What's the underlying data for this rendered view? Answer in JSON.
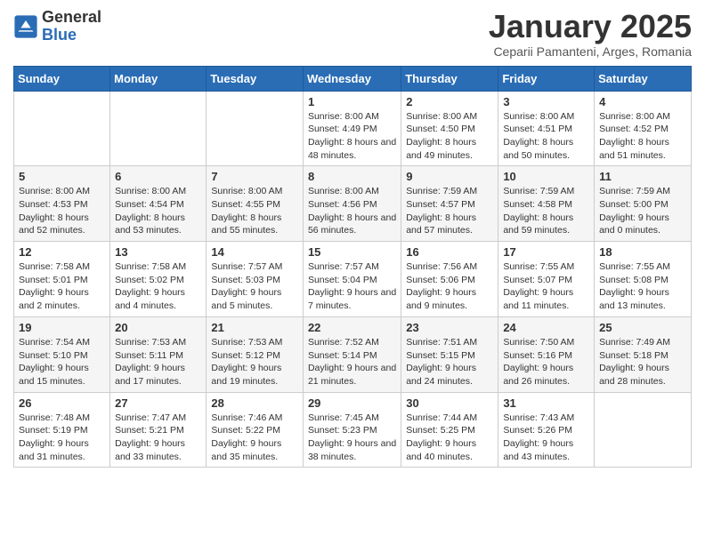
{
  "logo": {
    "general": "General",
    "blue": "Blue"
  },
  "header": {
    "month": "January 2025",
    "location": "Ceparii Pamanteni, Arges, Romania"
  },
  "weekdays": [
    "Sunday",
    "Monday",
    "Tuesday",
    "Wednesday",
    "Thursday",
    "Friday",
    "Saturday"
  ],
  "weeks": [
    [
      {
        "day": "",
        "sunrise": "",
        "sunset": "",
        "daylight": ""
      },
      {
        "day": "",
        "sunrise": "",
        "sunset": "",
        "daylight": ""
      },
      {
        "day": "",
        "sunrise": "",
        "sunset": "",
        "daylight": ""
      },
      {
        "day": "1",
        "sunrise": "Sunrise: 8:00 AM",
        "sunset": "Sunset: 4:49 PM",
        "daylight": "Daylight: 8 hours and 48 minutes."
      },
      {
        "day": "2",
        "sunrise": "Sunrise: 8:00 AM",
        "sunset": "Sunset: 4:50 PM",
        "daylight": "Daylight: 8 hours and 49 minutes."
      },
      {
        "day": "3",
        "sunrise": "Sunrise: 8:00 AM",
        "sunset": "Sunset: 4:51 PM",
        "daylight": "Daylight: 8 hours and 50 minutes."
      },
      {
        "day": "4",
        "sunrise": "Sunrise: 8:00 AM",
        "sunset": "Sunset: 4:52 PM",
        "daylight": "Daylight: 8 hours and 51 minutes."
      }
    ],
    [
      {
        "day": "5",
        "sunrise": "Sunrise: 8:00 AM",
        "sunset": "Sunset: 4:53 PM",
        "daylight": "Daylight: 8 hours and 52 minutes."
      },
      {
        "day": "6",
        "sunrise": "Sunrise: 8:00 AM",
        "sunset": "Sunset: 4:54 PM",
        "daylight": "Daylight: 8 hours and 53 minutes."
      },
      {
        "day": "7",
        "sunrise": "Sunrise: 8:00 AM",
        "sunset": "Sunset: 4:55 PM",
        "daylight": "Daylight: 8 hours and 55 minutes."
      },
      {
        "day": "8",
        "sunrise": "Sunrise: 8:00 AM",
        "sunset": "Sunset: 4:56 PM",
        "daylight": "Daylight: 8 hours and 56 minutes."
      },
      {
        "day": "9",
        "sunrise": "Sunrise: 7:59 AM",
        "sunset": "Sunset: 4:57 PM",
        "daylight": "Daylight: 8 hours and 57 minutes."
      },
      {
        "day": "10",
        "sunrise": "Sunrise: 7:59 AM",
        "sunset": "Sunset: 4:58 PM",
        "daylight": "Daylight: 8 hours and 59 minutes."
      },
      {
        "day": "11",
        "sunrise": "Sunrise: 7:59 AM",
        "sunset": "Sunset: 5:00 PM",
        "daylight": "Daylight: 9 hours and 0 minutes."
      }
    ],
    [
      {
        "day": "12",
        "sunrise": "Sunrise: 7:58 AM",
        "sunset": "Sunset: 5:01 PM",
        "daylight": "Daylight: 9 hours and 2 minutes."
      },
      {
        "day": "13",
        "sunrise": "Sunrise: 7:58 AM",
        "sunset": "Sunset: 5:02 PM",
        "daylight": "Daylight: 9 hours and 4 minutes."
      },
      {
        "day": "14",
        "sunrise": "Sunrise: 7:57 AM",
        "sunset": "Sunset: 5:03 PM",
        "daylight": "Daylight: 9 hours and 5 minutes."
      },
      {
        "day": "15",
        "sunrise": "Sunrise: 7:57 AM",
        "sunset": "Sunset: 5:04 PM",
        "daylight": "Daylight: 9 hours and 7 minutes."
      },
      {
        "day": "16",
        "sunrise": "Sunrise: 7:56 AM",
        "sunset": "Sunset: 5:06 PM",
        "daylight": "Daylight: 9 hours and 9 minutes."
      },
      {
        "day": "17",
        "sunrise": "Sunrise: 7:55 AM",
        "sunset": "Sunset: 5:07 PM",
        "daylight": "Daylight: 9 hours and 11 minutes."
      },
      {
        "day": "18",
        "sunrise": "Sunrise: 7:55 AM",
        "sunset": "Sunset: 5:08 PM",
        "daylight": "Daylight: 9 hours and 13 minutes."
      }
    ],
    [
      {
        "day": "19",
        "sunrise": "Sunrise: 7:54 AM",
        "sunset": "Sunset: 5:10 PM",
        "daylight": "Daylight: 9 hours and 15 minutes."
      },
      {
        "day": "20",
        "sunrise": "Sunrise: 7:53 AM",
        "sunset": "Sunset: 5:11 PM",
        "daylight": "Daylight: 9 hours and 17 minutes."
      },
      {
        "day": "21",
        "sunrise": "Sunrise: 7:53 AM",
        "sunset": "Sunset: 5:12 PM",
        "daylight": "Daylight: 9 hours and 19 minutes."
      },
      {
        "day": "22",
        "sunrise": "Sunrise: 7:52 AM",
        "sunset": "Sunset: 5:14 PM",
        "daylight": "Daylight: 9 hours and 21 minutes."
      },
      {
        "day": "23",
        "sunrise": "Sunrise: 7:51 AM",
        "sunset": "Sunset: 5:15 PM",
        "daylight": "Daylight: 9 hours and 24 minutes."
      },
      {
        "day": "24",
        "sunrise": "Sunrise: 7:50 AM",
        "sunset": "Sunset: 5:16 PM",
        "daylight": "Daylight: 9 hours and 26 minutes."
      },
      {
        "day": "25",
        "sunrise": "Sunrise: 7:49 AM",
        "sunset": "Sunset: 5:18 PM",
        "daylight": "Daylight: 9 hours and 28 minutes."
      }
    ],
    [
      {
        "day": "26",
        "sunrise": "Sunrise: 7:48 AM",
        "sunset": "Sunset: 5:19 PM",
        "daylight": "Daylight: 9 hours and 31 minutes."
      },
      {
        "day": "27",
        "sunrise": "Sunrise: 7:47 AM",
        "sunset": "Sunset: 5:21 PM",
        "daylight": "Daylight: 9 hours and 33 minutes."
      },
      {
        "day": "28",
        "sunrise": "Sunrise: 7:46 AM",
        "sunset": "Sunset: 5:22 PM",
        "daylight": "Daylight: 9 hours and 35 minutes."
      },
      {
        "day": "29",
        "sunrise": "Sunrise: 7:45 AM",
        "sunset": "Sunset: 5:23 PM",
        "daylight": "Daylight: 9 hours and 38 minutes."
      },
      {
        "day": "30",
        "sunrise": "Sunrise: 7:44 AM",
        "sunset": "Sunset: 5:25 PM",
        "daylight": "Daylight: 9 hours and 40 minutes."
      },
      {
        "day": "31",
        "sunrise": "Sunrise: 7:43 AM",
        "sunset": "Sunset: 5:26 PM",
        "daylight": "Daylight: 9 hours and 43 minutes."
      },
      {
        "day": "",
        "sunrise": "",
        "sunset": "",
        "daylight": ""
      }
    ]
  ]
}
